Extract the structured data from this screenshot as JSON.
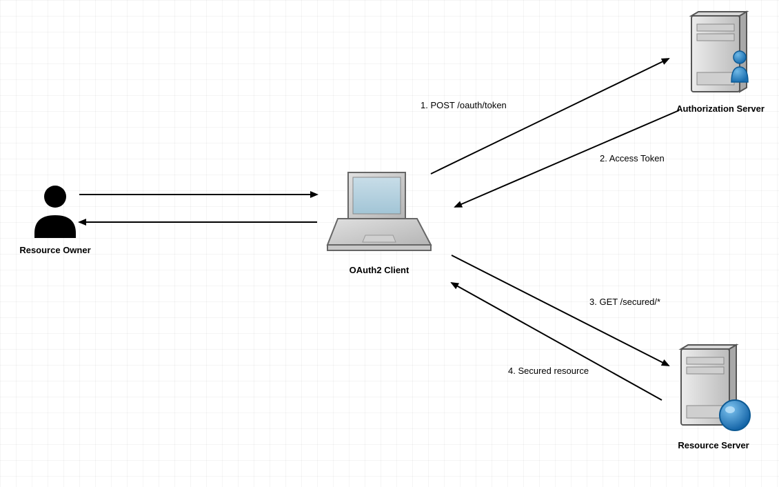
{
  "nodes": {
    "resource_owner": {
      "label": "Resource Owner"
    },
    "oauth_client": {
      "label": "OAuth2 Client"
    },
    "auth_server": {
      "label": "Authorization Server"
    },
    "resource_server": {
      "label": "Resource Server"
    }
  },
  "flows": {
    "step1": {
      "label": "1. POST /oauth/token"
    },
    "step2": {
      "label": "2. Access Token"
    },
    "step3": {
      "label": "3. GET /secured/*"
    },
    "step4": {
      "label": "4. Secured resource"
    }
  }
}
